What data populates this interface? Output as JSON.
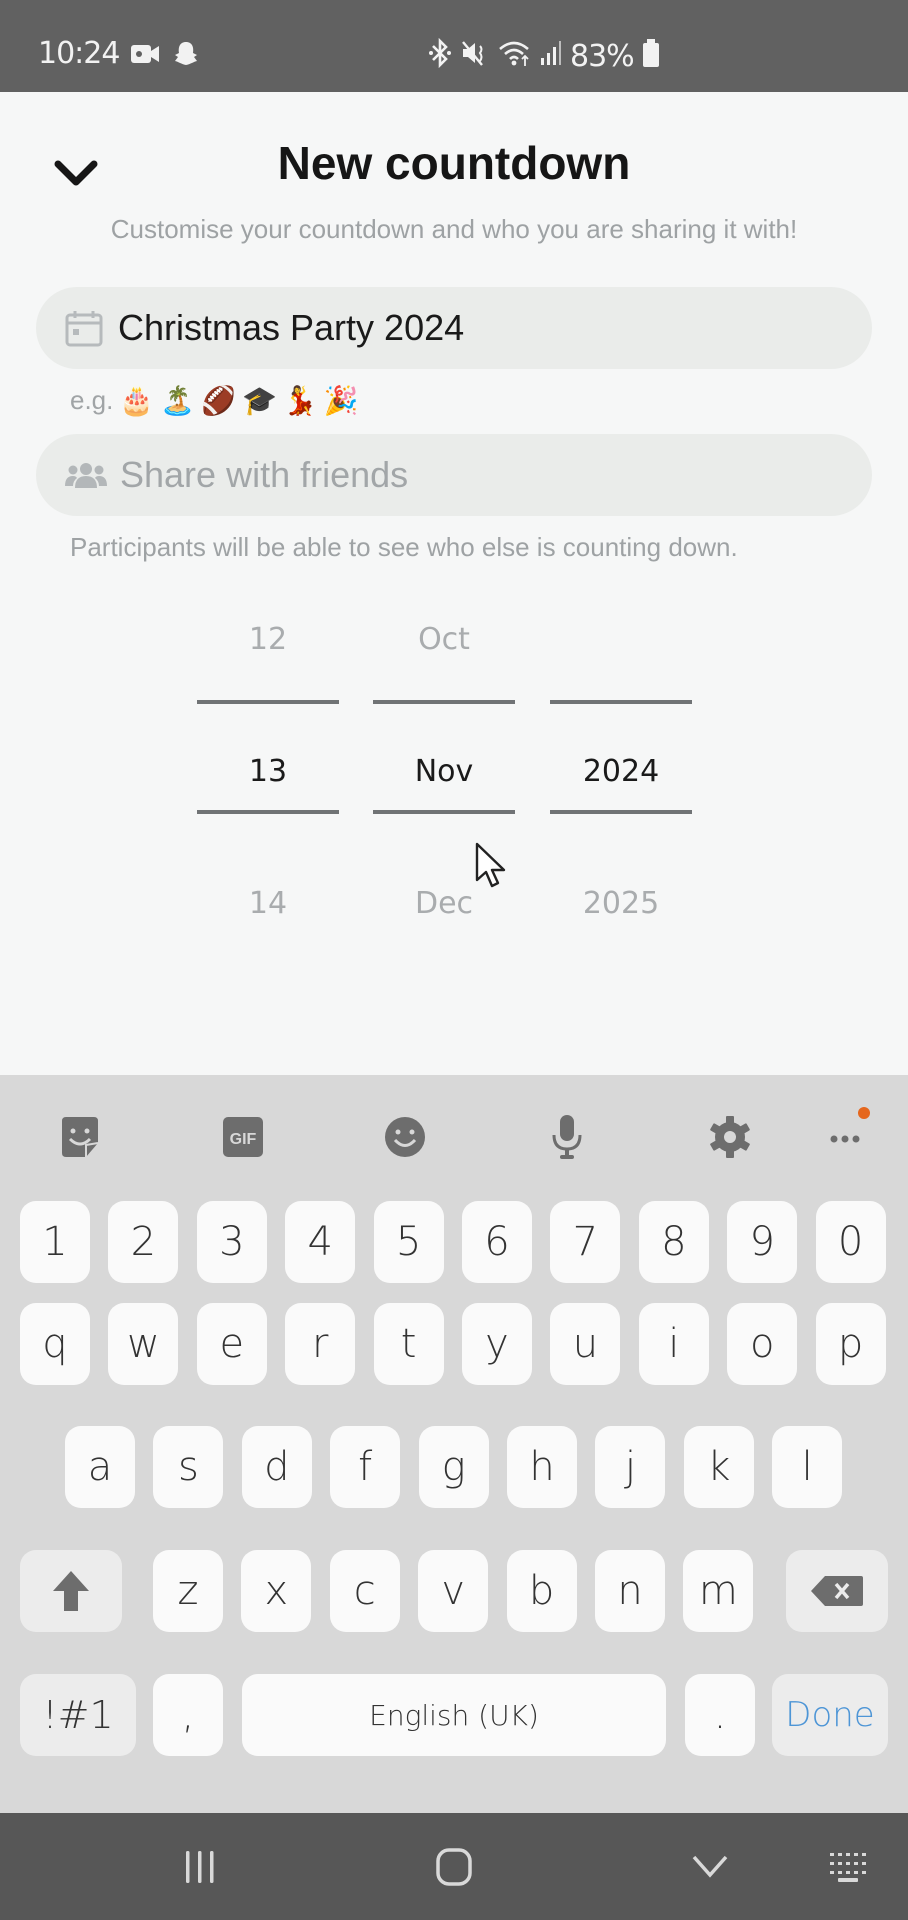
{
  "status_bar": {
    "time": "10:24",
    "left_icons": [
      "video-recording-icon",
      "snapchat-ghost-icon"
    ],
    "right_icons": [
      "bluetooth-icon",
      "mute-icon",
      "wifi-icon",
      "signal-icon"
    ],
    "battery_percent": "83%"
  },
  "header": {
    "title": "New countdown",
    "subtitle": "Customise your countdown and who you are sharing it with!"
  },
  "name_field": {
    "value": "Christmas Party 2024",
    "icon": "calendar-icon"
  },
  "examples": {
    "label": "e.g.",
    "emojis": [
      "🎂",
      "🏝️",
      "🏈",
      "🎓",
      "💃",
      "🎉"
    ]
  },
  "share_field": {
    "placeholder": "Share with friends",
    "icon": "friends-icon"
  },
  "share_hint": "Participants will be able to see who else is counting down.",
  "date_picker": {
    "day": {
      "prev": "12",
      "selected": "13",
      "next": "14"
    },
    "month": {
      "prev": "Oct",
      "selected": "Nov",
      "next": "Dec"
    },
    "year": {
      "prev": "",
      "selected": "2024",
      "next": "2025"
    }
  },
  "keyboard": {
    "toolbar": [
      "sticker-icon",
      "gif-icon",
      "emoji-icon",
      "microphone-icon",
      "settings-icon",
      "more-icon"
    ],
    "gif_label": "GIF",
    "row_numbers": [
      "1",
      "2",
      "3",
      "4",
      "5",
      "6",
      "7",
      "8",
      "9",
      "0"
    ],
    "row_1": [
      "q",
      "w",
      "e",
      "r",
      "t",
      "y",
      "u",
      "i",
      "o",
      "p"
    ],
    "row_2": [
      "a",
      "s",
      "d",
      "f",
      "g",
      "h",
      "j",
      "k",
      "l"
    ],
    "row_3": [
      "z",
      "x",
      "c",
      "v",
      "b",
      "n",
      "m"
    ],
    "symbols_label": "!#1",
    "comma": ",",
    "space_label": "English (UK)",
    "period": ".",
    "done_label": "Done"
  },
  "nav_bar": [
    "recent-apps-icon",
    "home-icon",
    "hide-keyboard-icon",
    "keyboard-switch-icon"
  ]
}
